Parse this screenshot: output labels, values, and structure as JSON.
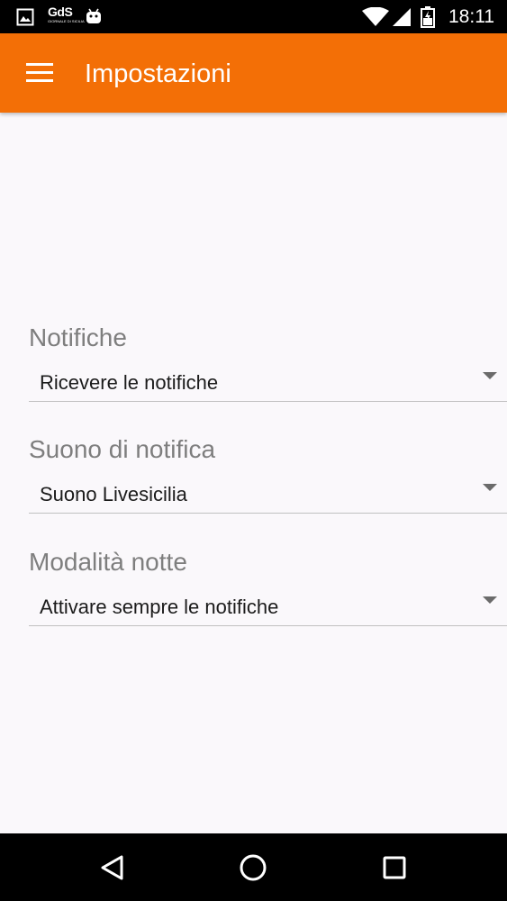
{
  "status_bar": {
    "time": "18:11",
    "app_logo_text": "GdS",
    "app_logo_subtext": "GIORNALE DI SICILIA",
    "icons": [
      "image-notification-icon",
      "gds-app-icon",
      "android-debug-icon",
      "wifi-icon",
      "cellular-signal-icon",
      "battery-icon"
    ]
  },
  "toolbar": {
    "title": "Impostazioni",
    "menu_icon": "hamburger-menu-icon"
  },
  "settings": [
    {
      "label": "Notifiche",
      "value": "Ricevere le notifiche"
    },
    {
      "label": "Suono di notifica",
      "value": "Suono Livesicilia"
    },
    {
      "label": "Modalità notte",
      "value": "Attivare sempre le notifiche"
    }
  ],
  "nav_bar": {
    "icons": [
      "back-icon",
      "home-icon",
      "recents-icon"
    ]
  },
  "colors": {
    "accent": "#f36f06",
    "background": "#faf8fb",
    "label": "#7e7e7e",
    "text": "#1b1b1b",
    "divider": "#c0c0c0"
  }
}
